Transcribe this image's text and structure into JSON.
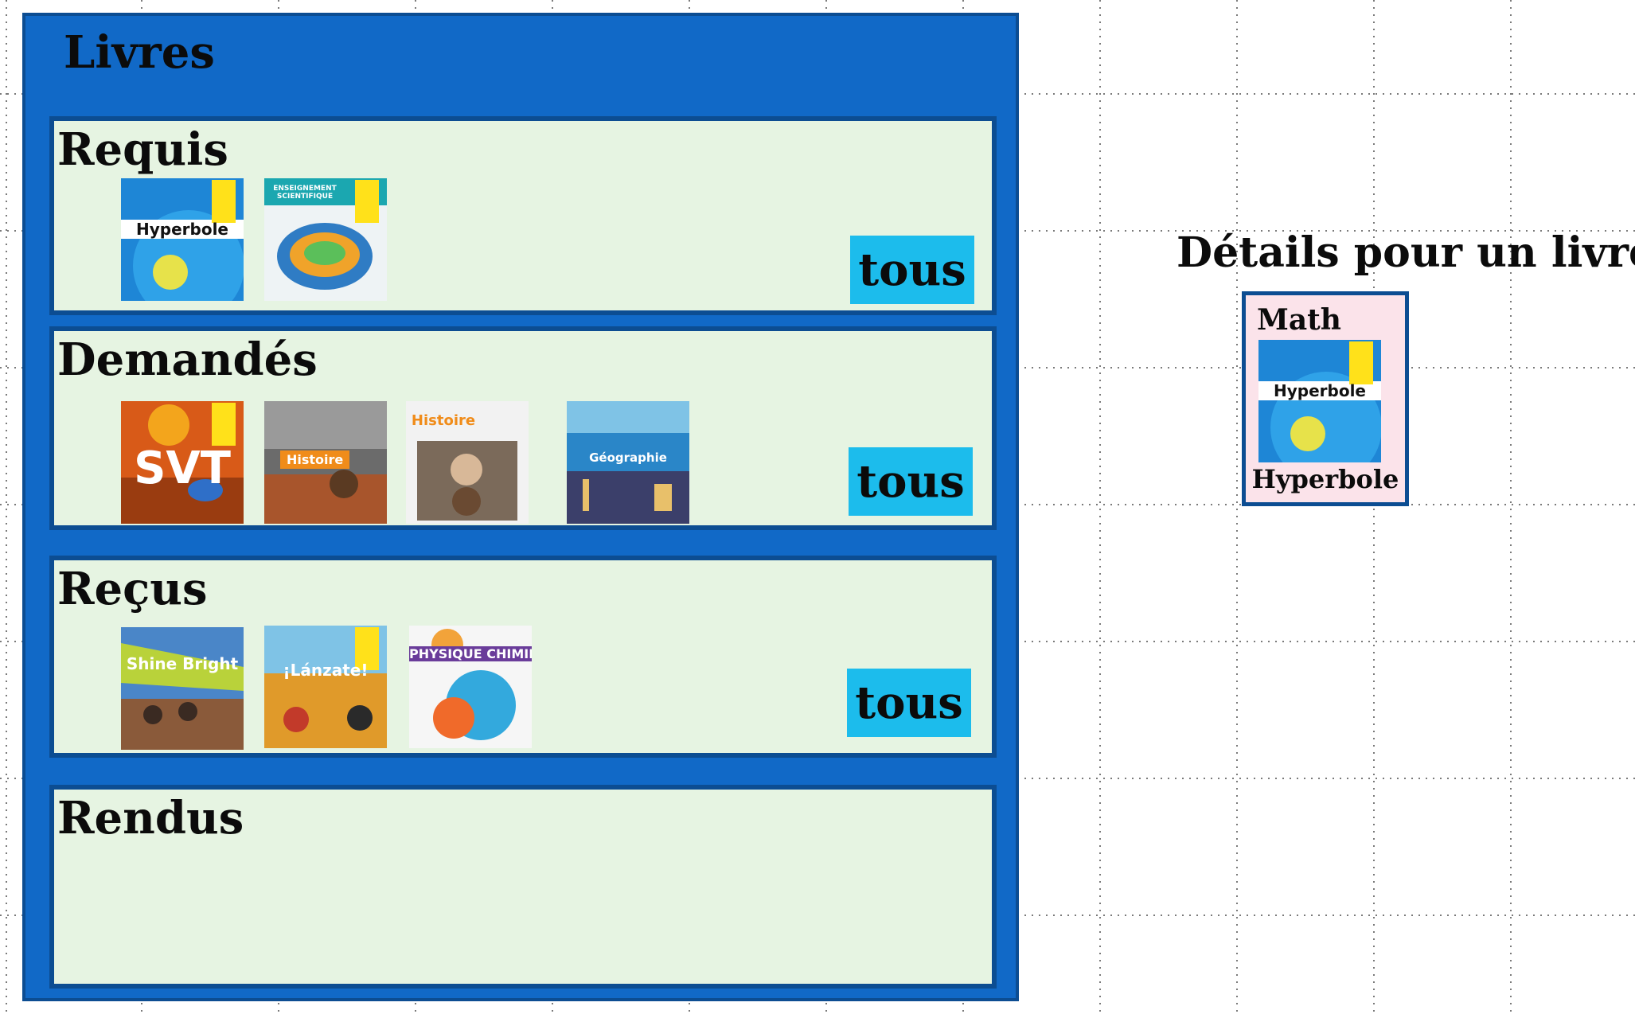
{
  "panel": {
    "title": "Livres"
  },
  "sections": [
    {
      "title": "Requis",
      "button": "tous",
      "books": [
        {
          "icon": "book-cover-icon",
          "cover_text": "Hyperbole",
          "theme": "#1e86d6"
        },
        {
          "icon": "book-cover-icon",
          "cover_text": "ENSEIGNEMENT SCIENTIFIQUE",
          "theme": "#1ba7b0"
        }
      ]
    },
    {
      "title": "Demandés",
      "button": "tous",
      "books": [
        {
          "icon": "book-cover-icon",
          "cover_text": "SVT",
          "theme": "#d85a18"
        },
        {
          "icon": "book-cover-icon",
          "cover_text": "Histoire",
          "theme": "#6b6b6b"
        },
        {
          "icon": "book-cover-icon",
          "cover_text": "Histoire",
          "theme": "#f2f2f2"
        },
        {
          "icon": "book-cover-icon",
          "cover_text": "Géographie",
          "theme": "#2a86c8"
        }
      ]
    },
    {
      "title": "Reçus",
      "button": "tous",
      "books": [
        {
          "icon": "book-cover-icon",
          "cover_text": "Shine Bright",
          "theme": "#b9d23a"
        },
        {
          "icon": "book-cover-icon",
          "cover_text": "¡Lánzate!",
          "theme": "#e09a2a"
        },
        {
          "icon": "book-cover-icon",
          "cover_text": "PHYSIQUE CHIMIE",
          "theme": "#33a9dd"
        }
      ]
    },
    {
      "title": "Rendus",
      "button": "",
      "books": []
    }
  ],
  "details": {
    "title": "Détails pour un livre",
    "subject": "Math",
    "book_name": "Hyperbole",
    "cover_text": "Hyperbole"
  }
}
